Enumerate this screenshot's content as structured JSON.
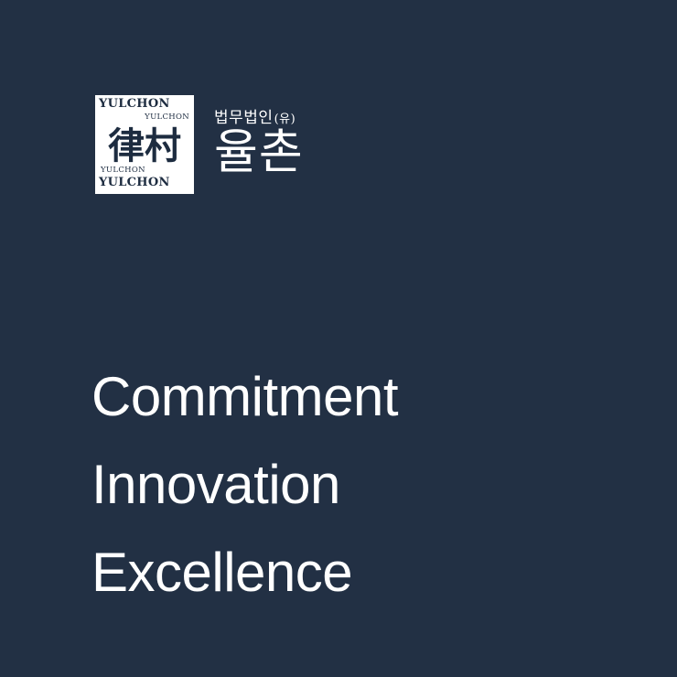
{
  "logo": {
    "seal_lines": [
      "YULCHON",
      "YULCHON",
      "YULCHON",
      "YULCHON"
    ],
    "seal_hanja": "律村",
    "firm_type": "법무법인",
    "firm_type_suffix": "(유)",
    "firm_name_korean": "율촌"
  },
  "taglines": [
    "Commitment",
    "Innovation",
    "Excellence"
  ],
  "colors": {
    "background": "#223044",
    "text": "#ffffff",
    "seal_ink": "#1d2c40"
  }
}
